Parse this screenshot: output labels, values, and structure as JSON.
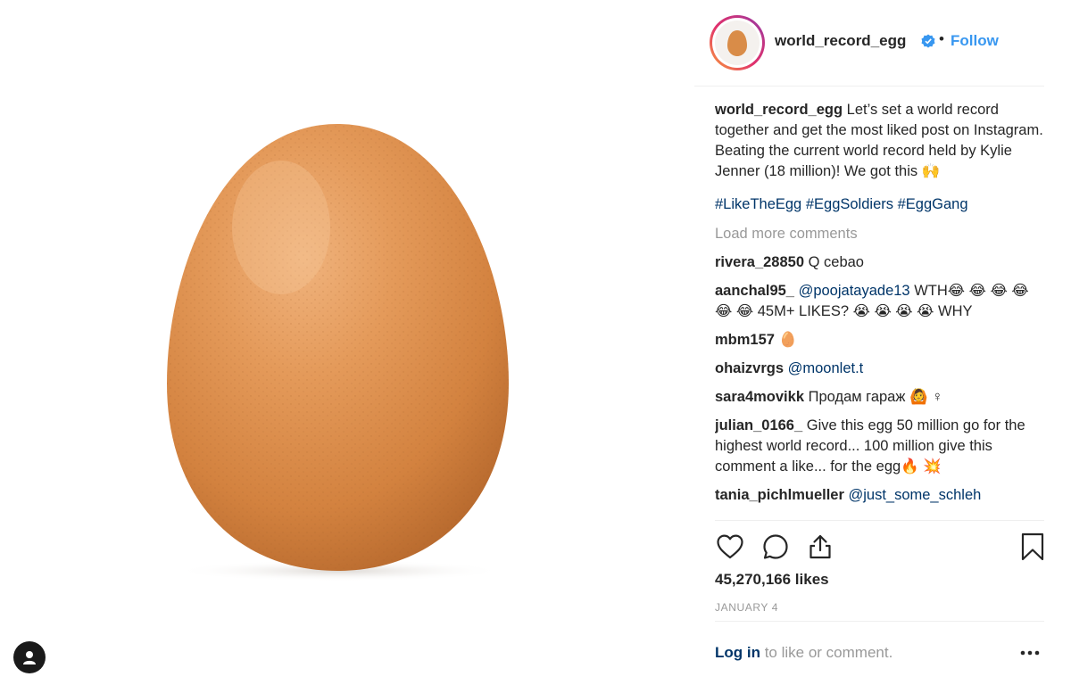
{
  "header": {
    "username": "world_record_egg",
    "separator": "•",
    "follow_label": "Follow"
  },
  "caption": {
    "username": "world_record_egg",
    "text": "Let’s set a world record together and get the most liked post on Instagram. Beating the current world record held by Kylie Jenner (18 million)! We got this 🙌",
    "hashtags": [
      "#LikeTheEgg",
      "#EggSoldiers",
      "#EggGang"
    ]
  },
  "load_more_label": "Load more comments",
  "comments": [
    {
      "username": "rivera_28850",
      "mention": "",
      "text": "Q cebao"
    },
    {
      "username": "aanchal95_",
      "mention": "@poojatayade13",
      "text": "WTH😂 😂 😂 😂 😂 😂  45M+ LIKES? 😭 😭 😭 😭  WHY"
    },
    {
      "username": "mbm157",
      "mention": "",
      "text": "🥚"
    },
    {
      "username": "ohaizvrgs",
      "mention": "@moonlet.t",
      "text": ""
    },
    {
      "username": "sara4movikk",
      "mention": "",
      "text": "Продам гараж 🙆 ♀"
    },
    {
      "username": "julian_0166_",
      "mention": "",
      "text": "Give this egg 50 million go for the highest world record... 100 million give this comment a like... for the egg🔥 💥"
    },
    {
      "username": "tania_pichlmueller",
      "mention": "@just_some_schleh",
      "text": ""
    }
  ],
  "likes_text": "45,270,166 likes",
  "date_text": "JANUARY 4",
  "footer": {
    "login_link": "Log in",
    "login_rest": " to like or comment."
  },
  "icons": {
    "like": "heart-icon",
    "comment": "comment-icon",
    "share": "share-icon",
    "save": "bookmark-icon",
    "more": "more-options-icon",
    "verified": "verified-badge-icon",
    "user": "user-profile-icon"
  },
  "colors": {
    "link_blue": "#3897f0",
    "hashtag_blue": "#003569",
    "muted": "#999999",
    "egg": "#d98c48"
  }
}
